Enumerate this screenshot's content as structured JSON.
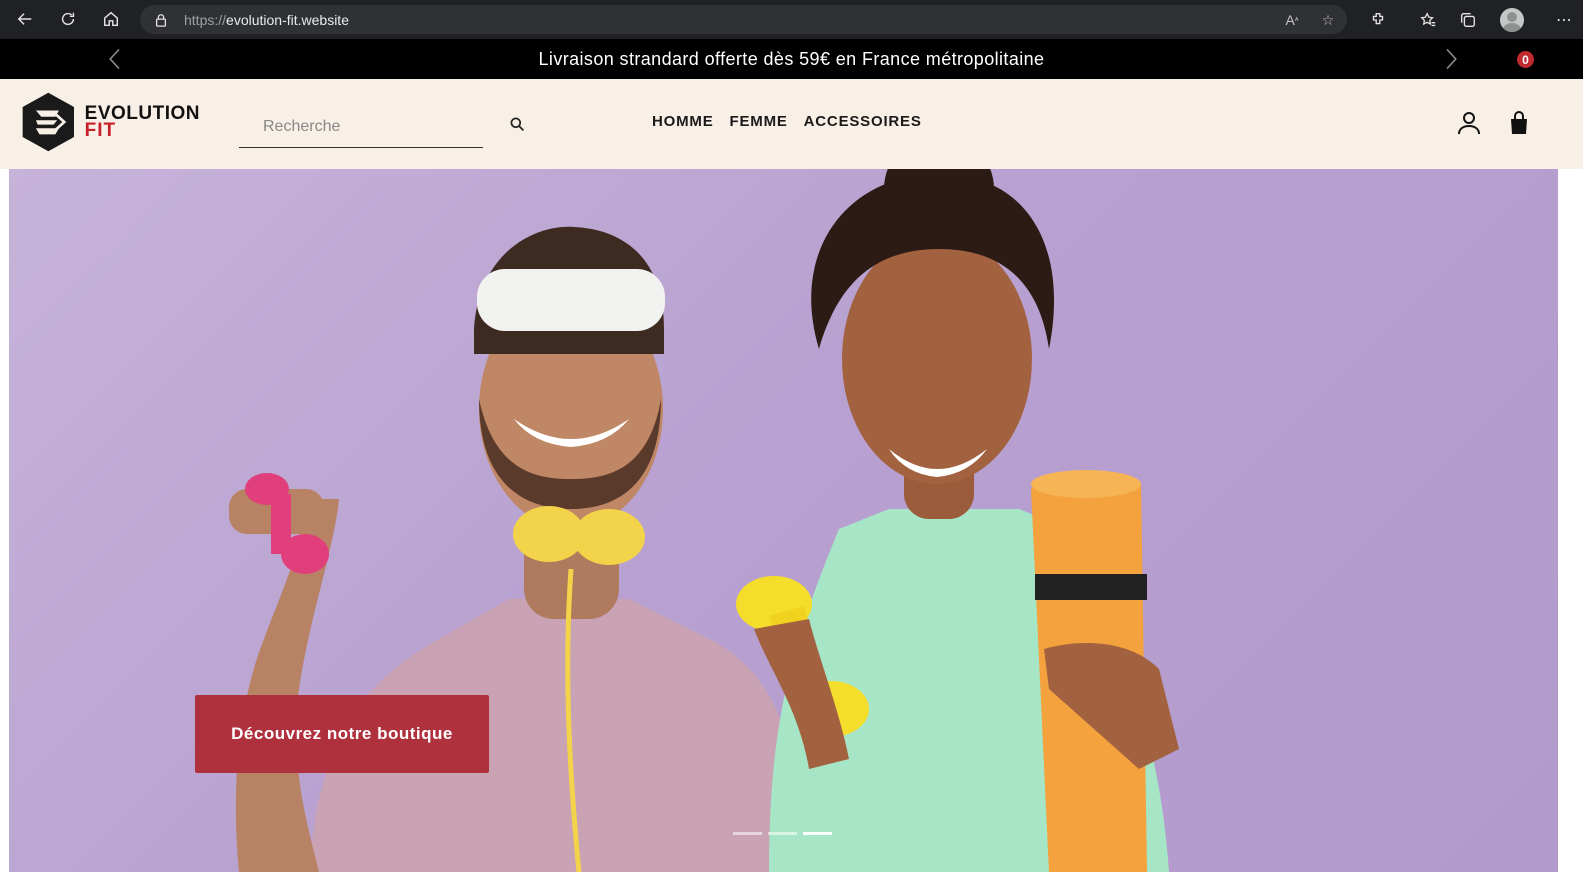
{
  "browser": {
    "url_protocol": "https://",
    "url_host": "evolution-fit.website"
  },
  "announcement": {
    "text": "Livraison strandard offerte dès 59€ en France métropolitaine"
  },
  "header": {
    "logo_line1": "EVOLUTION",
    "logo_line2": "FIT",
    "search_placeholder": "Recherche",
    "menu": [
      {
        "label": "HOMME"
      },
      {
        "label": "FEMME"
      },
      {
        "label": "ACCESSOIRES"
      }
    ],
    "cart_count": "0"
  },
  "hero": {
    "cta_label": "Découvrez notre boutique",
    "slides_total": 3,
    "active_slide": 3
  },
  "colors": {
    "announcement_bg": "#000000",
    "header_bg": "#f8efe6",
    "cta_bg": "#b0313e",
    "brand_red": "#c8202a",
    "hero_bg": "#b8a1d0"
  }
}
